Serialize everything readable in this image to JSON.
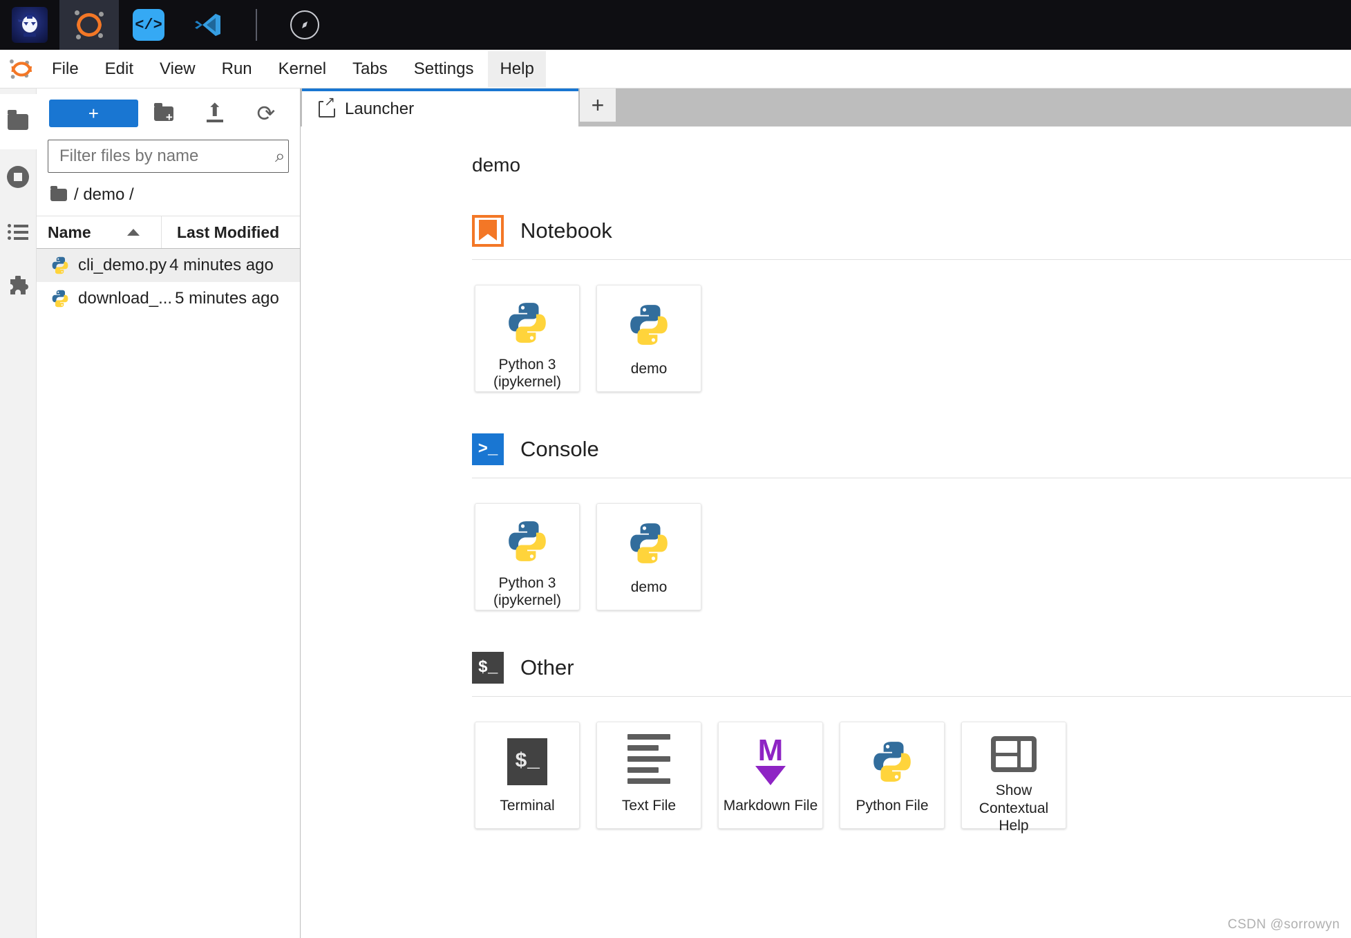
{
  "osbar": {
    "items": [
      {
        "name": "mascot-app-icon",
        "label": "Mascot"
      },
      {
        "name": "jupyterlab-app-icon",
        "label": "JupyterLab"
      },
      {
        "name": "code-editor-app-icon",
        "label": "Code Editor"
      },
      {
        "name": "vscode-app-icon",
        "label": "Visual Studio Code"
      },
      {
        "name": "compass-app-icon",
        "label": "Compass"
      }
    ],
    "code_glyph": "</>",
    "vscode_glyph": "⋈",
    "compass_glyph": "✦"
  },
  "menubar": {
    "items": [
      "File",
      "Edit",
      "View",
      "Run",
      "Kernel",
      "Tabs",
      "Settings",
      "Help"
    ],
    "open_item": "Help"
  },
  "activity_bar": {
    "items": [
      {
        "label": "File Browser",
        "icon": "folder-icon",
        "active": true
      },
      {
        "label": "Running Terminals and Kernels",
        "icon": "stop-circle-icon",
        "active": false
      },
      {
        "label": "Table of Contents",
        "icon": "list-icon",
        "active": false
      },
      {
        "label": "Extension Manager",
        "icon": "puzzle-icon",
        "active": false
      }
    ],
    "puzzle_glyph": "🧩"
  },
  "file_browser": {
    "new_button_label": "+",
    "toolbar_icons": [
      "new-folder-icon",
      "upload-icon",
      "refresh-icon"
    ],
    "refresh_glyph": "⟳",
    "filter_placeholder": "Filter files by name",
    "filter_value": "",
    "search_glyph": "⌕",
    "breadcrumb": "/ demo /",
    "columns": [
      "Name",
      "Last Modified"
    ],
    "sort_column": "Name",
    "sort_direction": "ascending",
    "rows": [
      {
        "name": "cli_demo.py",
        "modified": "4 minutes ago",
        "selected": true
      },
      {
        "name": "download_...",
        "modified": "5 minutes ago",
        "selected": false
      }
    ]
  },
  "dock": {
    "tabs": [
      {
        "label": "Launcher",
        "active": true
      }
    ],
    "add_tab_label": "+"
  },
  "launcher": {
    "cwd": "demo",
    "sections": [
      {
        "title": "Notebook",
        "icon": "notebook-bookmark-icon",
        "icon_glyph": "",
        "cards": [
          {
            "label": "Python 3\n(ipykernel)",
            "icon": "python-logo-icon"
          },
          {
            "label": "demo",
            "icon": "python-logo-icon"
          }
        ]
      },
      {
        "title": "Console",
        "icon": "console-prompt-icon",
        "icon_glyph": ">_",
        "cards": [
          {
            "label": "Python 3\n(ipykernel)",
            "icon": "python-logo-icon"
          },
          {
            "label": "demo",
            "icon": "python-logo-icon"
          }
        ]
      },
      {
        "title": "Other",
        "icon": "terminal-prompt-icon",
        "icon_glyph": "$_",
        "cards": [
          {
            "label": "Terminal",
            "icon": "terminal-icon",
            "icon_glyph": "$_"
          },
          {
            "label": "Text File",
            "icon": "text-file-icon"
          },
          {
            "label": "Markdown File",
            "icon": "markdown-icon",
            "icon_glyph": "M"
          },
          {
            "label": "Python File",
            "icon": "python-logo-icon"
          },
          {
            "label": "Show Contextual Help",
            "icon": "contextual-help-icon"
          }
        ]
      }
    ]
  },
  "watermark": "CSDN @sorrowyn",
  "colors": {
    "accent_blue": "#1976d2",
    "jupyter_orange": "#f37726",
    "markdown_purple": "#8e24c4",
    "python_blue": "#326d9c",
    "python_yellow": "#ffd43b",
    "dock_background": "#0e0e12",
    "tabbar_background": "#bdbdbd"
  }
}
